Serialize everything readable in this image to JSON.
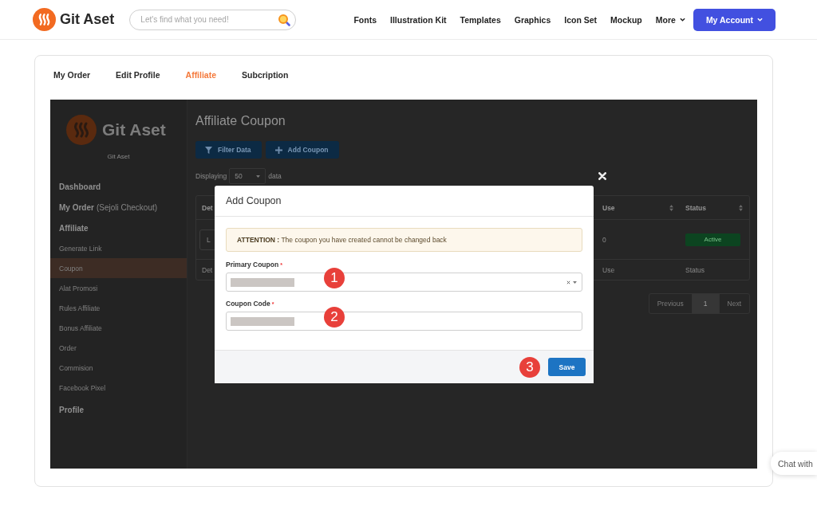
{
  "header": {
    "logo": "Git Aset",
    "search": {
      "placeholder": "Let's find what you need!"
    },
    "nav": [
      {
        "label": "Fonts",
        "kind": "link"
      },
      {
        "label": "Illustration Kit",
        "kind": "link"
      },
      {
        "label": "Templates",
        "kind": "link"
      },
      {
        "label": "Graphics",
        "kind": "link"
      },
      {
        "label": "Icon Set",
        "kind": "link"
      },
      {
        "label": "Mockup",
        "kind": "link"
      },
      {
        "label": "More",
        "kind": "dropdown"
      }
    ],
    "account_button": "My Account"
  },
  "tabs": [
    {
      "label": "My Order",
      "selected": false
    },
    {
      "label": "Edit Profile",
      "selected": false
    },
    {
      "label": "Affiliate",
      "selected": true
    },
    {
      "label": "Subcription",
      "selected": false
    }
  ],
  "dashboard": {
    "sidebar": {
      "logo": "Git Aset",
      "subtitle": "Git Aset",
      "items": [
        {
          "kind": "heading",
          "label": "Dashboard",
          "selected": false
        },
        {
          "kind": "heading",
          "label": "My Order",
          "note": "(Sejoli Checkout)",
          "selected": false
        },
        {
          "kind": "heading",
          "label": "Affiliate",
          "selected": false
        },
        {
          "kind": "sub",
          "label": "Generate Link",
          "selected": false
        },
        {
          "kind": "sub",
          "label": "Coupon",
          "selected": true
        },
        {
          "kind": "sub",
          "label": "Alat Promosi",
          "selected": false
        },
        {
          "kind": "sub",
          "label": "Rules Affiliate",
          "selected": false
        },
        {
          "kind": "sub",
          "label": "Bonus Affiliate",
          "selected": false
        },
        {
          "kind": "sub",
          "label": "Order",
          "selected": false
        },
        {
          "kind": "sub",
          "label": "Commision",
          "selected": false
        },
        {
          "kind": "sub",
          "label": "Facebook Pixel",
          "selected": false
        },
        {
          "kind": "heading",
          "label": "Profile",
          "selected": false
        }
      ]
    },
    "title": "Affiliate Coupon",
    "buttons": [
      {
        "kind": "filter",
        "label": "Filter Data"
      },
      {
        "kind": "add",
        "label": "Add Coupon"
      }
    ],
    "display": {
      "prefix": "Displaying",
      "value": "50",
      "suffix": "data"
    },
    "table": {
      "columns": [
        {
          "label": "Det"
        },
        {
          "label": "Use",
          "sortable": true
        },
        {
          "label": "Status",
          "sortable": true
        }
      ],
      "rows": [
        {
          "cells": [
            {
              "kind": "button",
              "text": "L"
            },
            {
              "kind": "text",
              "text": "0"
            },
            {
              "kind": "badge",
              "text": "Active"
            }
          ]
        }
      ],
      "footer": [
        "Det",
        "Use",
        "Status"
      ]
    },
    "pagination": {
      "previous": "Previous",
      "pages": [
        {
          "label": "1",
          "selected": true
        }
      ],
      "next": "Next"
    }
  },
  "modal": {
    "title": "Add Coupon",
    "attention": "**ATTENTION :** The coupon you have created cannot be changed back",
    "fields": [
      {
        "kind": "select",
        "label": "Primary Coupon",
        "required_mark": "*",
        "redacted": true,
        "marker": "1"
      },
      {
        "kind": "text",
        "label": "Coupon Code",
        "required_mark": "*",
        "redacted": true,
        "marker": "2"
      }
    ],
    "save": {
      "label": "Save",
      "marker": "3"
    }
  },
  "chat": {
    "label": "Chat with"
  }
}
